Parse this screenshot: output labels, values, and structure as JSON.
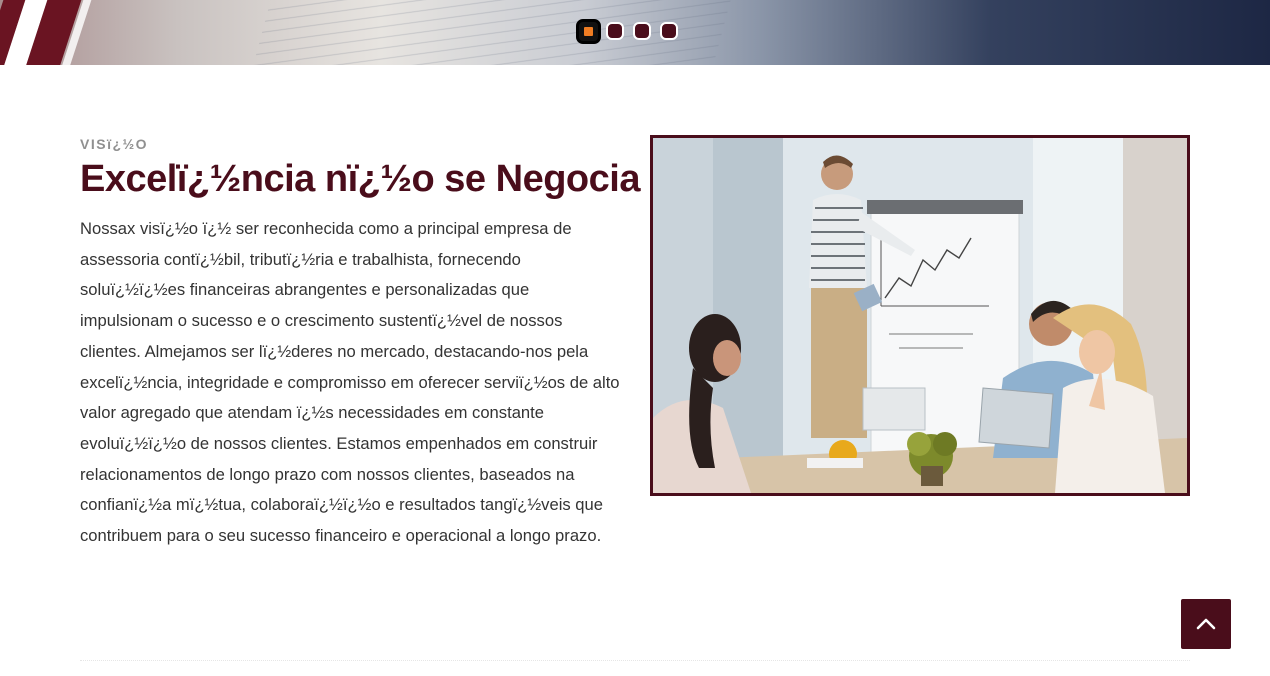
{
  "slider": {
    "dots": [
      {
        "label": "slide-1",
        "active": true
      },
      {
        "label": "slide-2",
        "active": false
      },
      {
        "label": "slide-3",
        "active": false
      },
      {
        "label": "slide-4",
        "active": false
      }
    ]
  },
  "section": {
    "eyebrow": "VISï¿½O",
    "title": "Excelï¿½ncia nï¿½o se Negocia",
    "body": "Nossax visï¿½o ï¿½ ser reconhecida como a principal empresa de assessoria contï¿½bil, tributï¿½ria e trabalhista, fornecendo soluï¿½ï¿½es financeiras abrangentes e personalizadas que impulsionam o sucesso e o crescimento sustentï¿½vel de nossos clientes. Almejamos ser lï¿½deres no mercado, destacando-nos pela excelï¿½ncia, integridade e compromisso em oferecer serviï¿½os de alto valor agregado que atendam ï¿½s necessidades em constante evoluï¿½ï¿½o de nossos clientes. Estamos empenhados em construir relacionamentos de longo prazo com nossos clientes, baseados na confianï¿½a mï¿½tua, colaboraï¿½ï¿½o e resultados tangï¿½veis que contribuem para o seu sucesso financeiro e operacional a longo prazo."
  },
  "colors": {
    "brand": "#4a0d1b",
    "active_dot": "#f07d23",
    "text": "#333333",
    "eyebrow": "#909090"
  },
  "icons": {
    "back_to_top": "chevron-up-icon"
  }
}
